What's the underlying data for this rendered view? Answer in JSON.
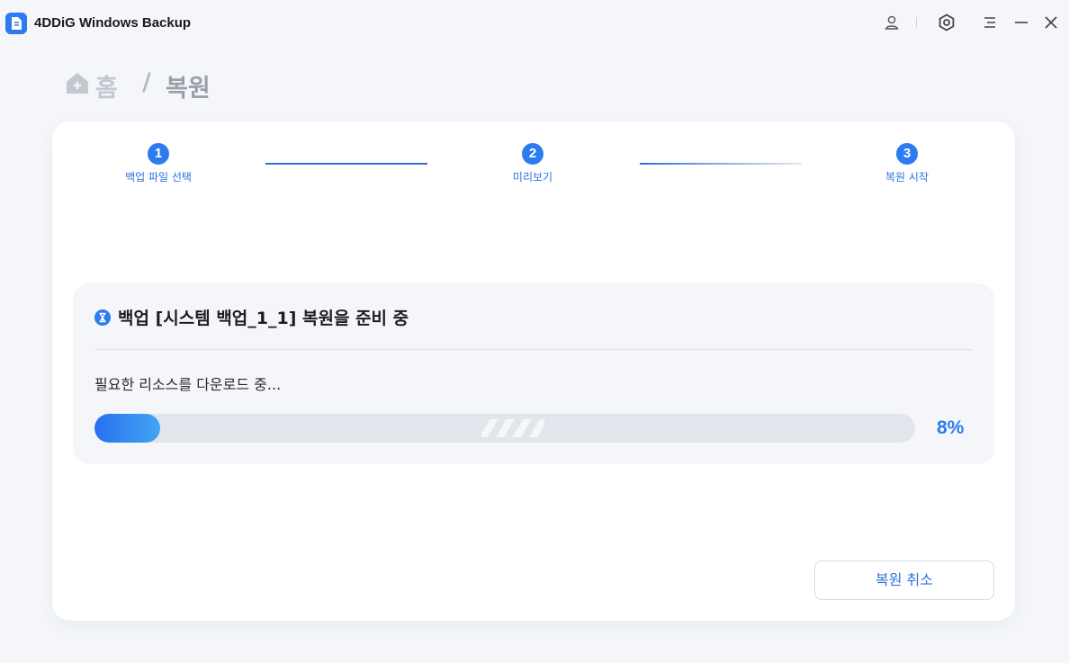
{
  "app": {
    "title": "4DDiG Windows Backup"
  },
  "window_controls": [
    {
      "name": "account-icon"
    },
    {
      "name": "settings-icon"
    },
    {
      "name": "menu-icon"
    },
    {
      "name": "minimize-icon"
    },
    {
      "name": "close-icon"
    }
  ],
  "breadcrumb": {
    "home": "홈",
    "separator": "/",
    "current": "복원"
  },
  "steps": [
    {
      "number": "1",
      "label": "백업 파일 선택"
    },
    {
      "number": "2",
      "label": "미리보기"
    },
    {
      "number": "3",
      "label": "복원 시작"
    }
  ],
  "progress": {
    "title": "백업 [시스템 백업_1_1] 복원을 준비 중",
    "status": "필요한 리소스를 다운로드 중...",
    "percent_label": "8%",
    "value": 0.08
  },
  "cancel_label": "복원 취소",
  "colors": {
    "accent": "#2d7bf0",
    "background": "#f4f6fa",
    "card": "#ffffff",
    "track": "#e2e5ec"
  }
}
